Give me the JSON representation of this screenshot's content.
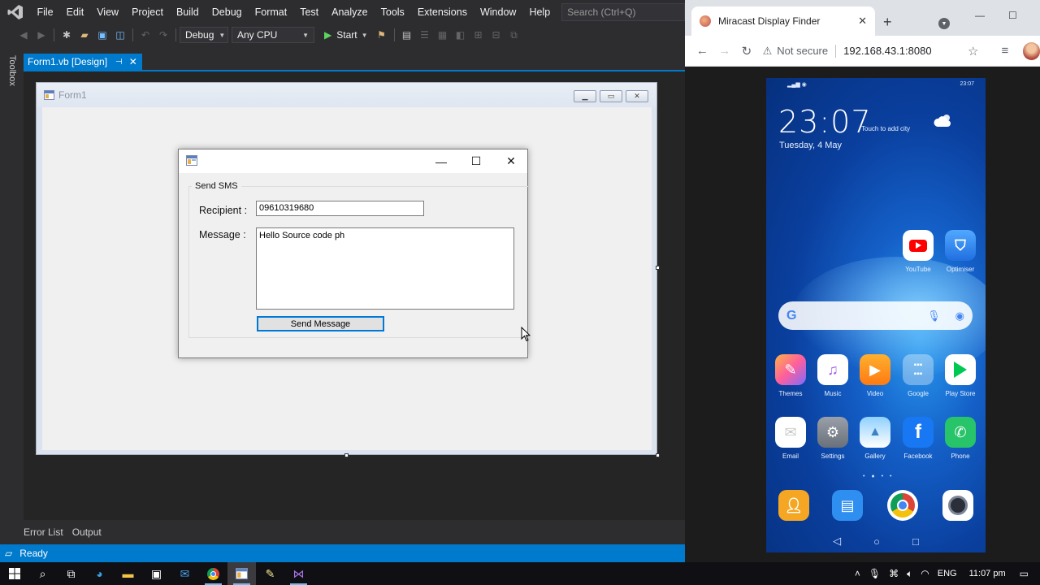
{
  "vs": {
    "menu": [
      "File",
      "Edit",
      "View",
      "Project",
      "Build",
      "Debug",
      "Format",
      "Test",
      "Analyze",
      "Tools",
      "Extensions",
      "Window",
      "Help"
    ],
    "search_placeholder": "Search (Ctrl+Q)",
    "toolbar": {
      "config": "Debug",
      "platform": "Any CPU",
      "start_label": "Start"
    },
    "toolbox_label": "Toolbox",
    "doc_tab": "Form1.vb [Design]",
    "design_form_title": "Form1",
    "bottom_tabs": [
      "Error List",
      "Output"
    ],
    "status": "Ready"
  },
  "sms_app": {
    "group_label": "Send SMS",
    "recipient_label": "Recipient :",
    "recipient_value": "09610319680",
    "message_label": "Message :",
    "message_value": "Hello Source code ph",
    "send_button": "Send Message"
  },
  "chrome": {
    "tab_title": "Miracast Display Finder",
    "security_label": "Not secure",
    "url": "192.168.43.1:8080"
  },
  "phone": {
    "status_time": "23:07",
    "clock": "23:07",
    "add_city": "Touch to add city",
    "date": "Tuesday, 4 May",
    "apps": [
      {
        "label": "YouTube",
        "color": "#ffffff"
      },
      {
        "label": "Optimiser",
        "color": "#2f8ff0"
      },
      {
        "label": "Themes",
        "color": "#ff6f91"
      },
      {
        "label": "Music",
        "color": "#ffffff"
      },
      {
        "label": "Video",
        "color": "#ff9a1f"
      },
      {
        "label": "Google",
        "color": "#ffffff"
      },
      {
        "label": "Play Store",
        "color": "#ffffff"
      },
      {
        "label": "Email",
        "color": "#ffffff"
      },
      {
        "label": "Settings",
        "color": "#8c8c94"
      },
      {
        "label": "Gallery",
        "color": "#ffffff"
      },
      {
        "label": "Facebook",
        "color": "#1877f2"
      },
      {
        "label": "Phone",
        "color": "#2ecc71"
      }
    ],
    "dock": [
      {
        "name": "contacts",
        "color": "#f5a623"
      },
      {
        "name": "messages",
        "color": "#2f8ff0"
      },
      {
        "name": "chrome",
        "color": "#ffffff"
      },
      {
        "name": "camera",
        "color": "#ffffff"
      }
    ]
  },
  "taskbar": {
    "language": "ENG",
    "time": "11:07 pm"
  }
}
